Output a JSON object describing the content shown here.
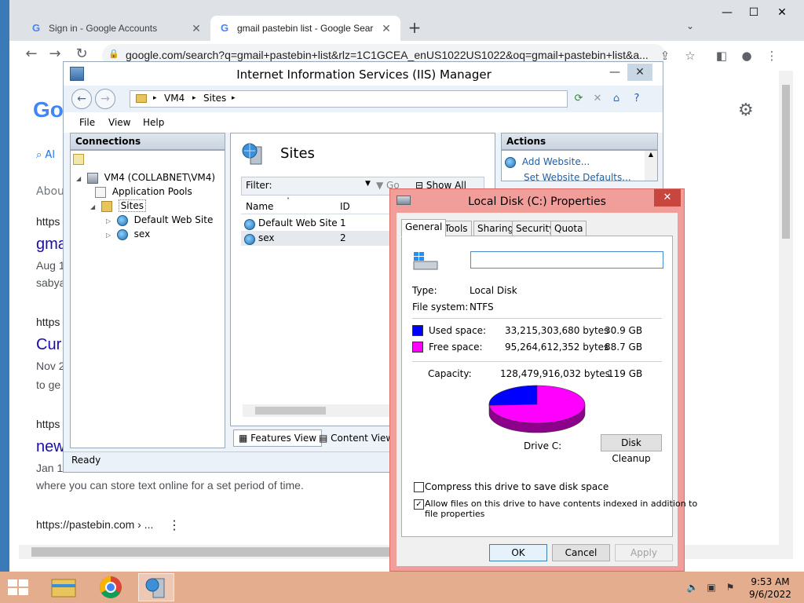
{
  "browser": {
    "tabs": [
      {
        "title": "Sign in - Google Accounts"
      },
      {
        "title": "gmail pastebin list - Google Sear"
      }
    ],
    "url": "google.com/search?q=gmail+pastebin+list&rlz=1C1GCEA_enUS1022US1022&oq=gmail+pastebin+list&a..."
  },
  "google_page": {
    "logo": "Go",
    "all_tab": "Al",
    "about": "Abou",
    "results": [
      {
        "url": "https",
        "title": "gma",
        "snippet1": "Aug 1",
        "snippet2": "sabya"
      },
      {
        "url": "https",
        "title": "Cur",
        "snippet1": "Nov 2",
        "snippet2": "to ge"
      },
      {
        "url": "https",
        "title": "new",
        "snippet1": "Jan 1"
      }
    ],
    "snippet_full": "where you can store text online for a set period of time.",
    "pastebin_url": "https://pastebin.com › ...",
    "menu_dots": "⋮"
  },
  "iis": {
    "title": "Internet Information Services (IIS) Manager",
    "breadcrumb": [
      "VM4",
      "Sites"
    ],
    "menu": [
      "File",
      "View",
      "Help"
    ],
    "connections": {
      "header": "Connections",
      "tree": {
        "server": "VM4 (COLLABNET\\VM4)",
        "app_pools": "Application Pools",
        "sites": "Sites",
        "site1": "Default Web Site",
        "site2": "sex"
      }
    },
    "sites": {
      "title": "Sites",
      "filter_label": "Filter:",
      "go": "Go",
      "show_all": "Show All",
      "columns": [
        "Name",
        "ID"
      ],
      "rows": [
        {
          "name": "Default Web Site",
          "id": "1"
        },
        {
          "name": "sex",
          "id": "2"
        }
      ]
    },
    "view_tabs": [
      "Features View",
      "Content View"
    ],
    "actions": {
      "header": "Actions",
      "items": [
        "Add Website...",
        "Set Website Defaults..."
      ]
    },
    "status": "Ready"
  },
  "properties": {
    "title": "Local Disk (C:) Properties",
    "tabs": [
      "General",
      "Tools",
      "Sharing",
      "Security",
      "Quota"
    ],
    "name_value": "",
    "type_label": "Type:",
    "type_value": "Local Disk",
    "fs_label": "File system:",
    "fs_value": "NTFS",
    "used_label": "Used space:",
    "used_bytes": "33,215,303,680 bytes",
    "used_gb": "30.9 GB",
    "free_label": "Free space:",
    "free_bytes": "95,264,612,352 bytes",
    "free_gb": "88.7 GB",
    "capacity_label": "Capacity:",
    "capacity_bytes": "128,479,916,032 bytes",
    "capacity_gb": "119 GB",
    "used_fraction": 0.2585,
    "used_color": "#0000ff",
    "free_color": "#ff00ff",
    "drive_label": "Drive C:",
    "disk_cleanup": "Disk Cleanup",
    "compress_label": "Compress this drive to save disk space",
    "compress_checked": false,
    "index_label_1": "Allow files on this drive to have contents indexed in addition to",
    "index_label_2": "file properties",
    "index_checked": true,
    "ok": "OK",
    "cancel": "Cancel",
    "apply": "Apply"
  },
  "taskbar": {
    "time": "9:53 AM",
    "date": "9/6/2022"
  }
}
